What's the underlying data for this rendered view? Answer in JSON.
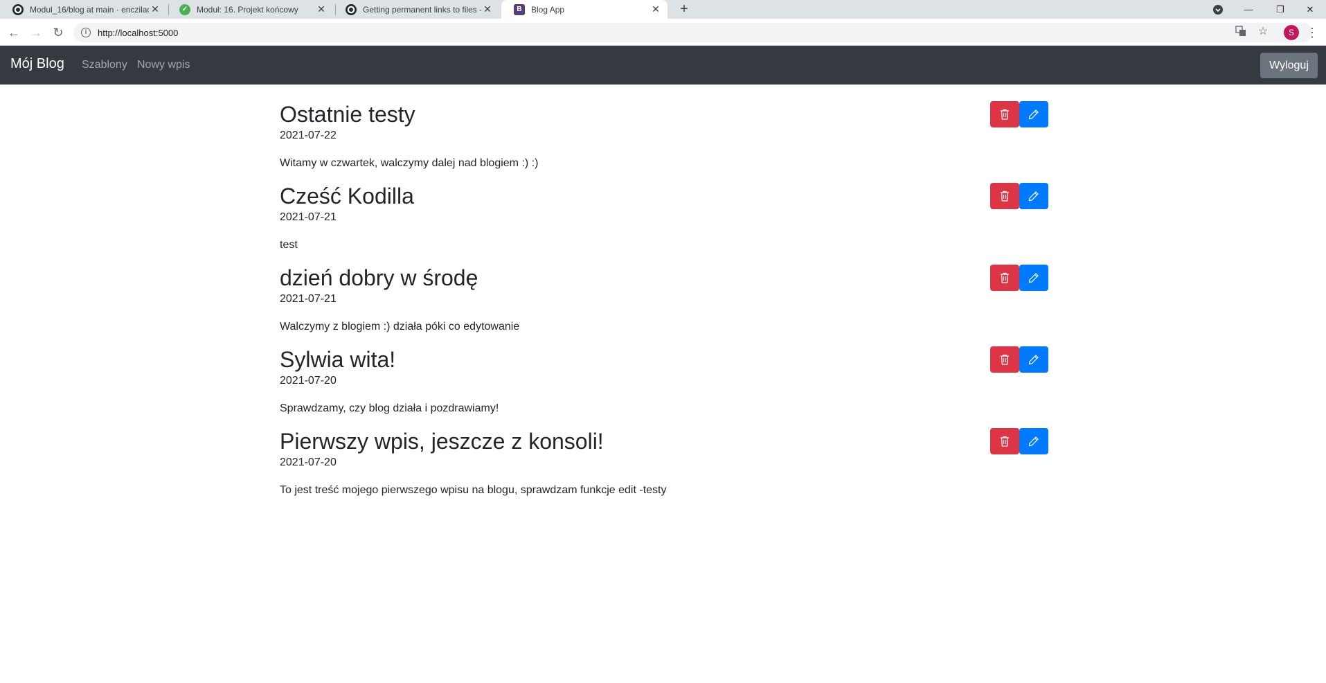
{
  "browser": {
    "tabs": [
      {
        "title": "Modul_16/blog at main · enczilac",
        "icon": "github-icon"
      },
      {
        "title": "Moduł: 16. Projekt końcowy",
        "icon": "kodilla-icon"
      },
      {
        "title": "Getting permanent links to files -",
        "icon": "github-icon"
      },
      {
        "title": "Blog App",
        "icon": "bootstrap-icon",
        "active": true
      }
    ],
    "new_tab_label": "+",
    "url": "http://localhost:5000",
    "profile_initial": "S"
  },
  "navbar": {
    "brand": "Mój Blog",
    "links": [
      "Szablony",
      "Nowy wpis"
    ],
    "logout": "Wyloguj"
  },
  "posts": [
    {
      "title": "Ostatnie testy",
      "date": "2021-07-22",
      "body": "Witamy w czwartek, walczymy dalej nad blogiem :) :)"
    },
    {
      "title": "Cześć Kodilla",
      "date": "2021-07-21",
      "body": "test"
    },
    {
      "title": "dzień dobry w środę",
      "date": "2021-07-21",
      "body": "Walczymy z blogiem :) działa póki co edytowanie"
    },
    {
      "title": "Sylwia wita!",
      "date": "2021-07-20",
      "body": "Sprawdzamy, czy blog działa i pozdrawiamy!"
    },
    {
      "title": "Pierwszy wpis, jeszcze z konsoli!",
      "date": "2021-07-20",
      "body": "To jest treść mojego pierwszego wpisu na blogu, sprawdzam funkcje edit -testy"
    }
  ],
  "colors": {
    "navbar_bg": "#343a40",
    "delete_button": "#dc3545",
    "edit_button": "#007bff",
    "logout_button": "#6c757d"
  }
}
